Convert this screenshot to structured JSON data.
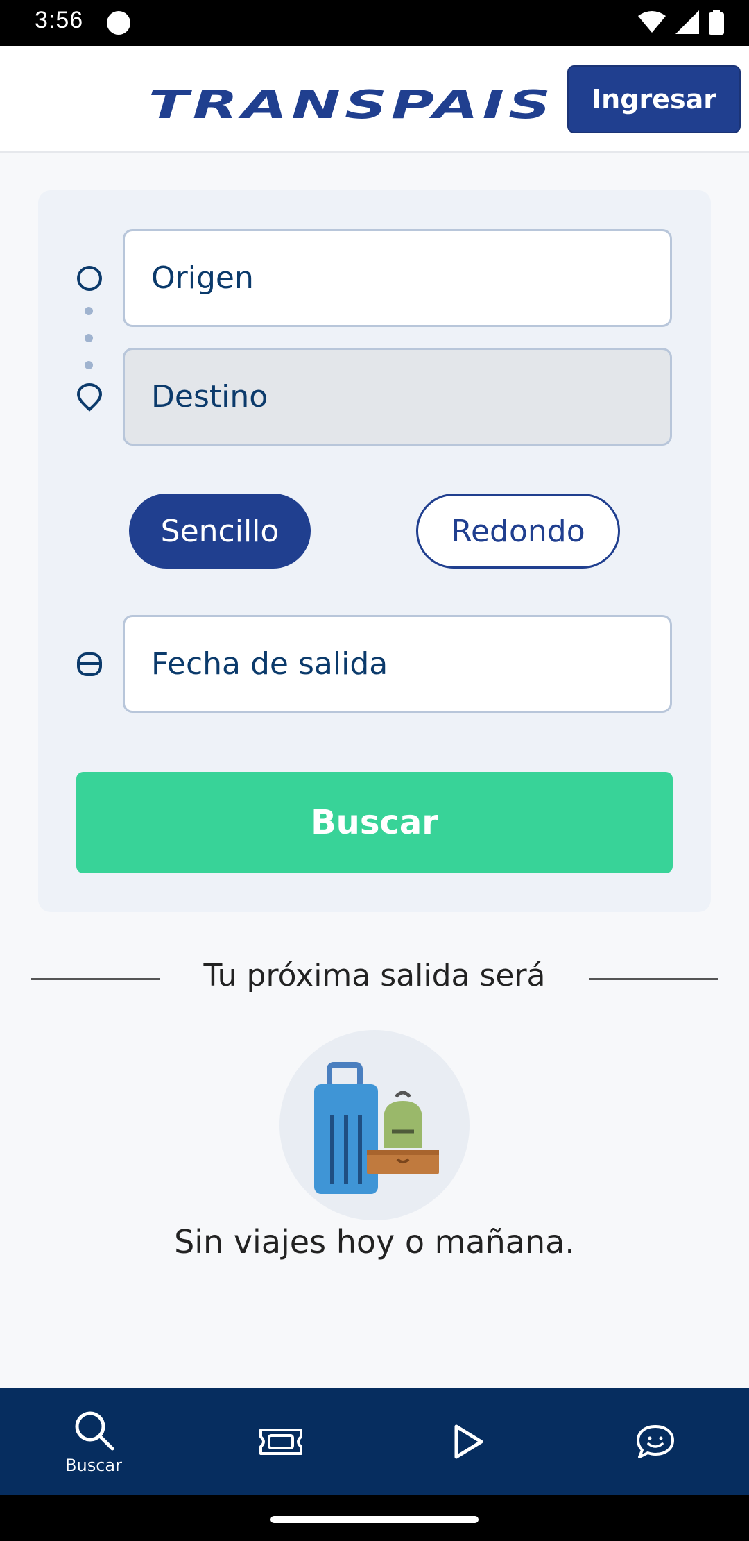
{
  "status_bar": {
    "time": "3:56"
  },
  "header": {
    "logo_text": "TRANSPAIS",
    "login_label": "Ingresar"
  },
  "search": {
    "origin_placeholder": "Origen",
    "destination_placeholder": "Destino",
    "trip_types": [
      "Sencillo",
      "Redondo"
    ],
    "selected_trip_type": "Sencillo",
    "date_placeholder": "Fecha de salida",
    "search_label": "Buscar"
  },
  "next_departure": {
    "title": "Tu próxima salida será",
    "empty_message": "Sin viajes hoy o mañana."
  },
  "bottom_nav": {
    "items": [
      {
        "label": "Buscar",
        "icon": "search-icon"
      },
      {
        "label": "",
        "icon": "ticket-icon"
      },
      {
        "label": "",
        "icon": "play-icon"
      },
      {
        "label": "",
        "icon": "chat-icon"
      }
    ]
  },
  "colors": {
    "primary": "#203f8f",
    "accent": "#38d398",
    "nav_bg": "#062d5f"
  }
}
